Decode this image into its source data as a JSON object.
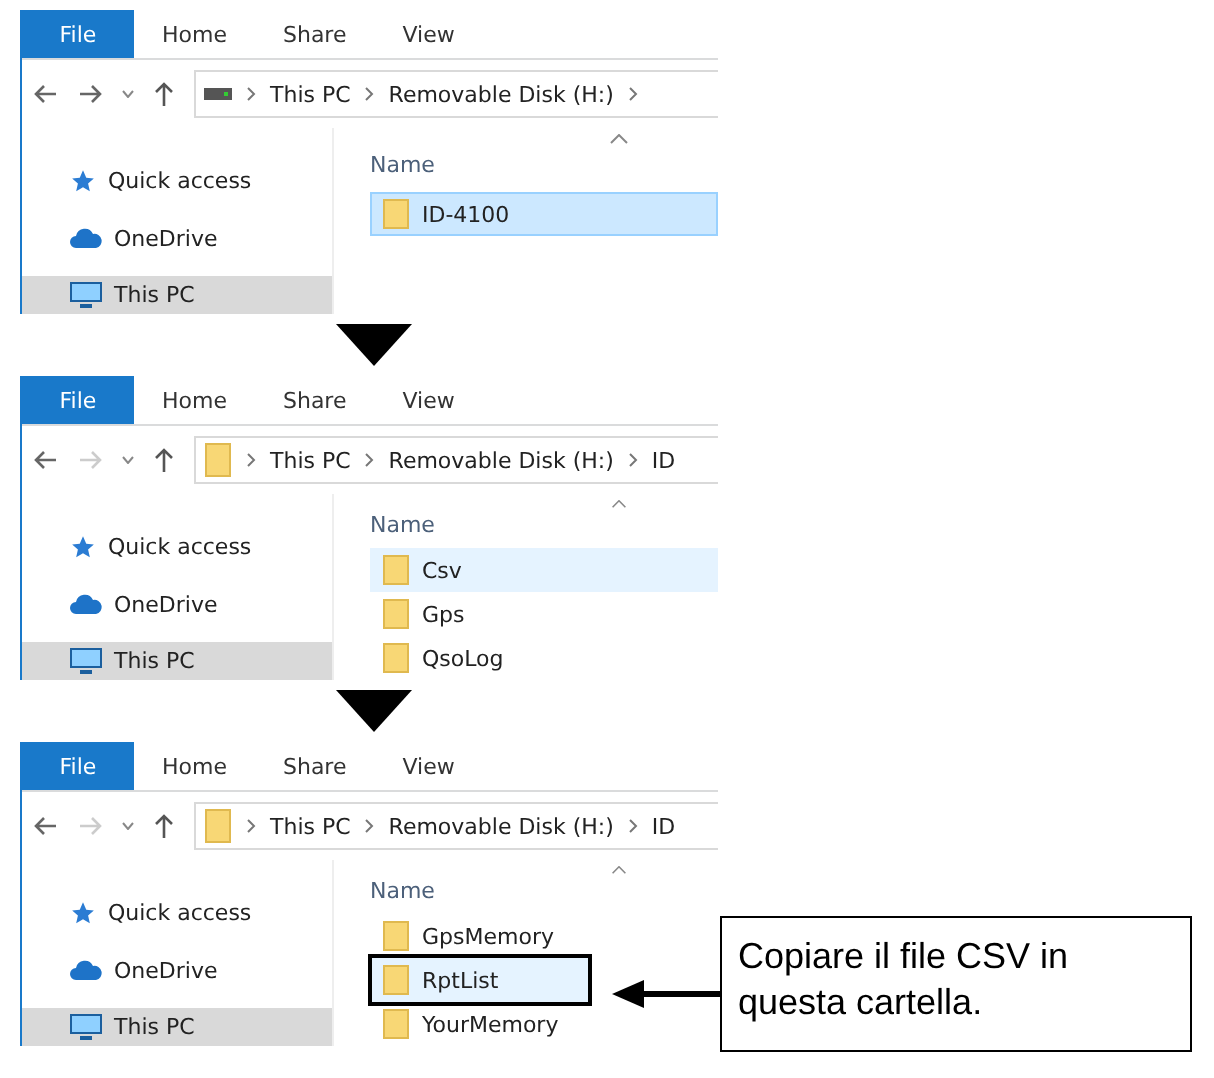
{
  "panels": [
    {
      "tabs": [
        {
          "label": "File",
          "selected": true
        },
        {
          "label": "Home",
          "selected": false
        },
        {
          "label": "Share",
          "selected": false
        },
        {
          "label": "View",
          "selected": false
        }
      ],
      "forward_enabled": true,
      "location": {
        "kind": "drive"
      },
      "breadcrumbs": [
        "This PC",
        "Removable Disk (H:)"
      ],
      "trailing_separator": true,
      "nav_items": [
        {
          "label": "Quick access",
          "kind": "star",
          "selected": false
        },
        {
          "label": "OneDrive",
          "kind": "cloud",
          "selected": false
        },
        {
          "label": "This PC",
          "kind": "monitor",
          "selected": true
        }
      ],
      "column_header": "Name",
      "files": [
        {
          "name": "ID-4100",
          "selected": true,
          "hovered": false,
          "framed": false
        }
      ]
    },
    {
      "tabs": [
        {
          "label": "File",
          "selected": true
        },
        {
          "label": "Home",
          "selected": false
        },
        {
          "label": "Share",
          "selected": false
        },
        {
          "label": "View",
          "selected": false
        }
      ],
      "forward_enabled": false,
      "location": {
        "kind": "folder"
      },
      "breadcrumbs": [
        "This PC",
        "Removable Disk (H:)",
        "ID"
      ],
      "trailing_separator": false,
      "nav_items": [
        {
          "label": "Quick access",
          "kind": "star",
          "selected": false
        },
        {
          "label": "OneDrive",
          "kind": "cloud",
          "selected": false
        },
        {
          "label": "This PC",
          "kind": "monitor",
          "selected": true
        }
      ],
      "column_header": "Name",
      "files": [
        {
          "name": "Csv",
          "selected": false,
          "hovered": true,
          "framed": false
        },
        {
          "name": "Gps",
          "selected": false,
          "hovered": false,
          "framed": false
        },
        {
          "name": "QsoLog",
          "selected": false,
          "hovered": false,
          "framed": false
        }
      ]
    },
    {
      "tabs": [
        {
          "label": "File",
          "selected": true
        },
        {
          "label": "Home",
          "selected": false
        },
        {
          "label": "Share",
          "selected": false
        },
        {
          "label": "View",
          "selected": false
        }
      ],
      "forward_enabled": false,
      "location": {
        "kind": "folder"
      },
      "breadcrumbs": [
        "This PC",
        "Removable Disk (H:)",
        "ID"
      ],
      "trailing_separator": false,
      "nav_items": [
        {
          "label": "Quick access",
          "kind": "star",
          "selected": false
        },
        {
          "label": "OneDrive",
          "kind": "cloud",
          "selected": false
        },
        {
          "label": "This PC",
          "kind": "monitor",
          "selected": true
        }
      ],
      "column_header": "Name",
      "files": [
        {
          "name": "GpsMemory",
          "selected": false,
          "hovered": false,
          "framed": false
        },
        {
          "name": "RptList",
          "selected": false,
          "hovered": true,
          "framed": true
        },
        {
          "name": "YourMemory",
          "selected": false,
          "hovered": false,
          "framed": false
        }
      ]
    }
  ],
  "callout": {
    "text": "Copiare il file CSV in questa cartella."
  }
}
